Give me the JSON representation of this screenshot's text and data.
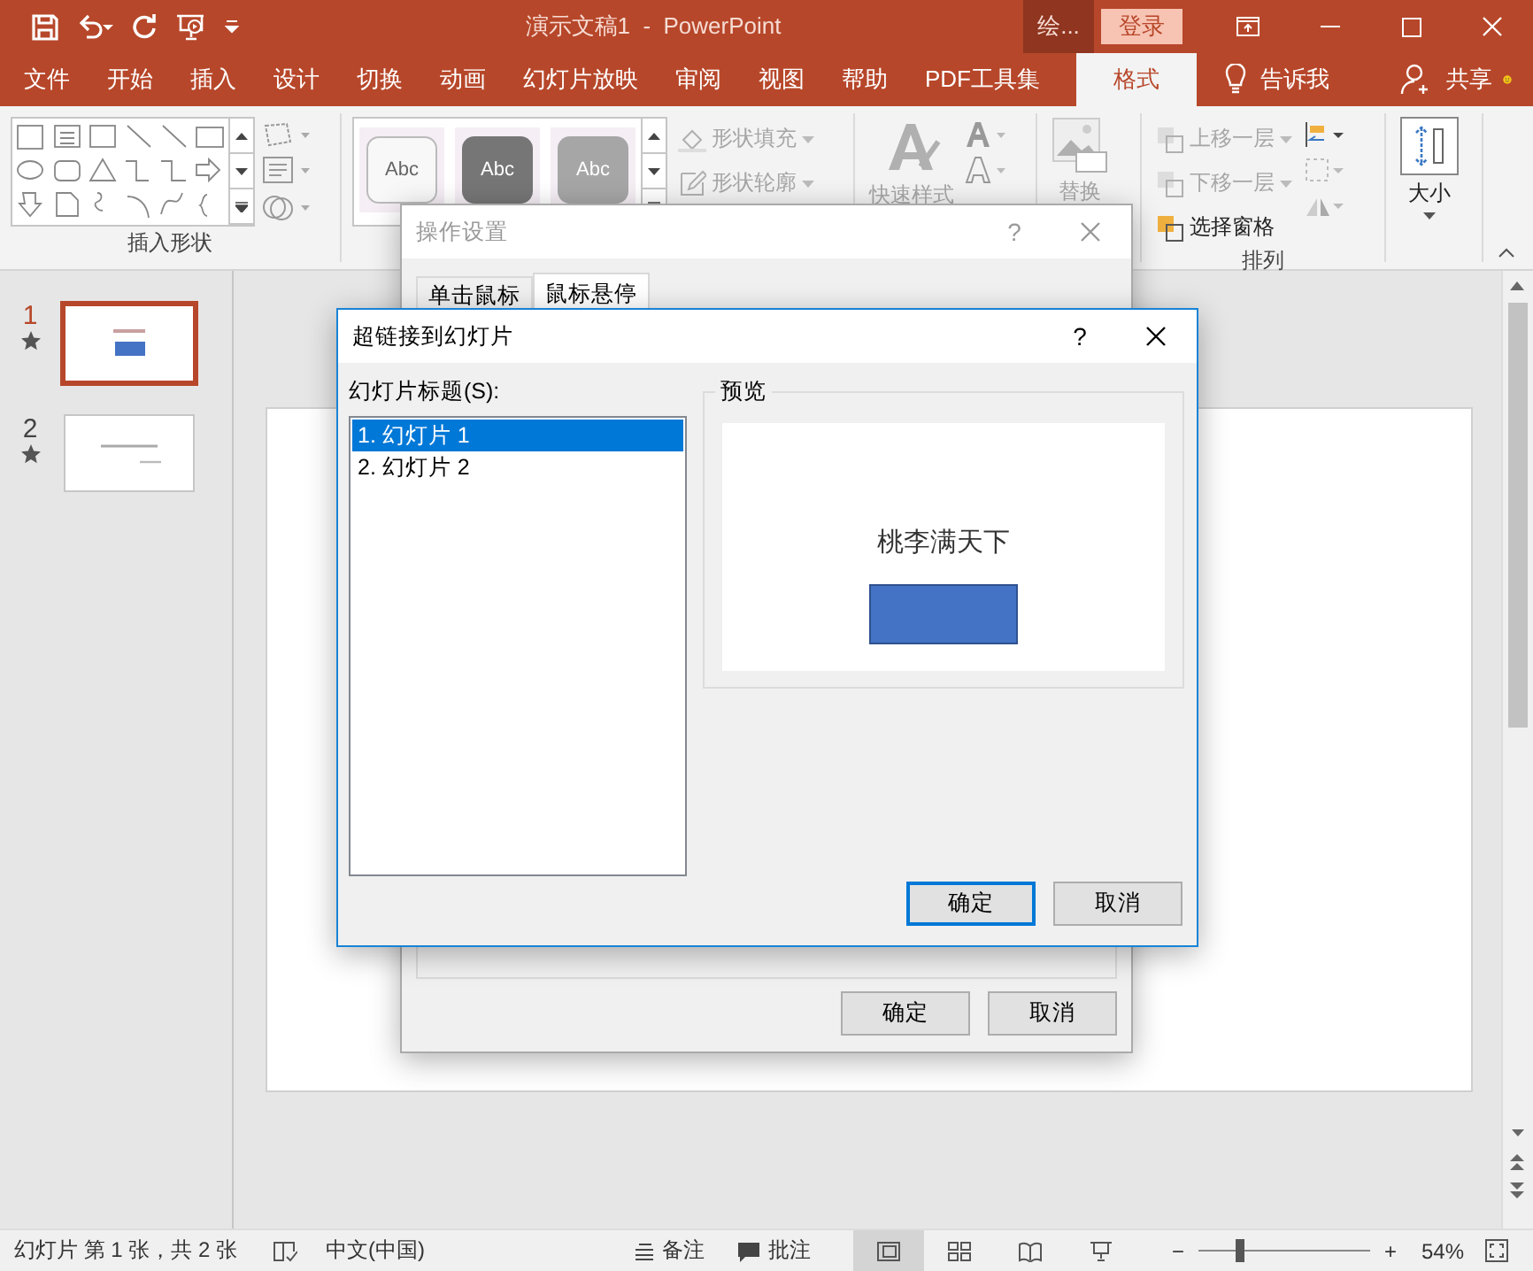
{
  "title_bar": {
    "title": "演示文稿1  -  PowerPoint",
    "context_tab": "绘...",
    "sign_in": "登录"
  },
  "ribbon_tabs": [
    {
      "label": "文件",
      "selected": false
    },
    {
      "label": "开始",
      "selected": false
    },
    {
      "label": "插入",
      "selected": false
    },
    {
      "label": "设计",
      "selected": false
    },
    {
      "label": "切换",
      "selected": false
    },
    {
      "label": "动画",
      "selected": false
    },
    {
      "label": "幻灯片放映",
      "selected": false
    },
    {
      "label": "审阅",
      "selected": false
    },
    {
      "label": "视图",
      "selected": false
    },
    {
      "label": "帮助",
      "selected": false
    },
    {
      "label": "PDF工具集",
      "selected": false
    },
    {
      "label": "格式",
      "selected": true
    }
  ],
  "tell_me": "告诉我",
  "share": "共享",
  "ribbon": {
    "insert_shapes": "插入形状",
    "style_gallery": [
      "Abc",
      "Abc",
      "Abc"
    ],
    "shape_fill": {
      "label": "形状填充",
      "disabled": true
    },
    "shape_outline": {
      "label": "形状轮廓",
      "disabled": true
    },
    "quick_styles": {
      "label": "快速样式",
      "disabled": true
    },
    "replace": {
      "label": "替换",
      "disabled": true
    },
    "arrange": {
      "label": "排列",
      "items": [
        {
          "label": "上移一层",
          "disabled": true
        },
        {
          "label": "下移一层",
          "disabled": true
        },
        {
          "label": "选择窗格",
          "disabled": false
        }
      ]
    },
    "size": "大小"
  },
  "slides": [
    {
      "number": "1",
      "selected": true
    },
    {
      "number": "2",
      "selected": false
    }
  ],
  "action_dialog": {
    "title": "操作设置",
    "help": "?",
    "tabs": [
      {
        "label": "单击鼠标",
        "selected": false
      },
      {
        "label": "鼠标悬停",
        "selected": true
      }
    ],
    "buttons": [
      "确定",
      "取消"
    ]
  },
  "hyperlink_dialog": {
    "title": "超链接到幻灯片",
    "help": "?",
    "list_label": "幻灯片标题(S):",
    "items": [
      {
        "label": "1. 幻灯片 1",
        "selected": true
      },
      {
        "label": "2. 幻灯片 2",
        "selected": false
      }
    ],
    "preview_label": "预览",
    "preview_title": "桃李满天下",
    "buttons": [
      {
        "label": "确定",
        "default": true
      },
      {
        "label": "取消",
        "default": false
      }
    ]
  },
  "status_bar": {
    "slide_info": "幻灯片 第 1 张，共 2 张",
    "language": "中文(中国)",
    "notes": "备注",
    "comments": "批注",
    "views": [
      {
        "selected": true
      },
      {
        "selected": false
      },
      {
        "selected": false
      },
      {
        "selected": false
      }
    ],
    "zoom_out": "−",
    "zoom_in": "+",
    "zoom_slider": {
      "level": 0.24
    },
    "zoom": "54%"
  }
}
